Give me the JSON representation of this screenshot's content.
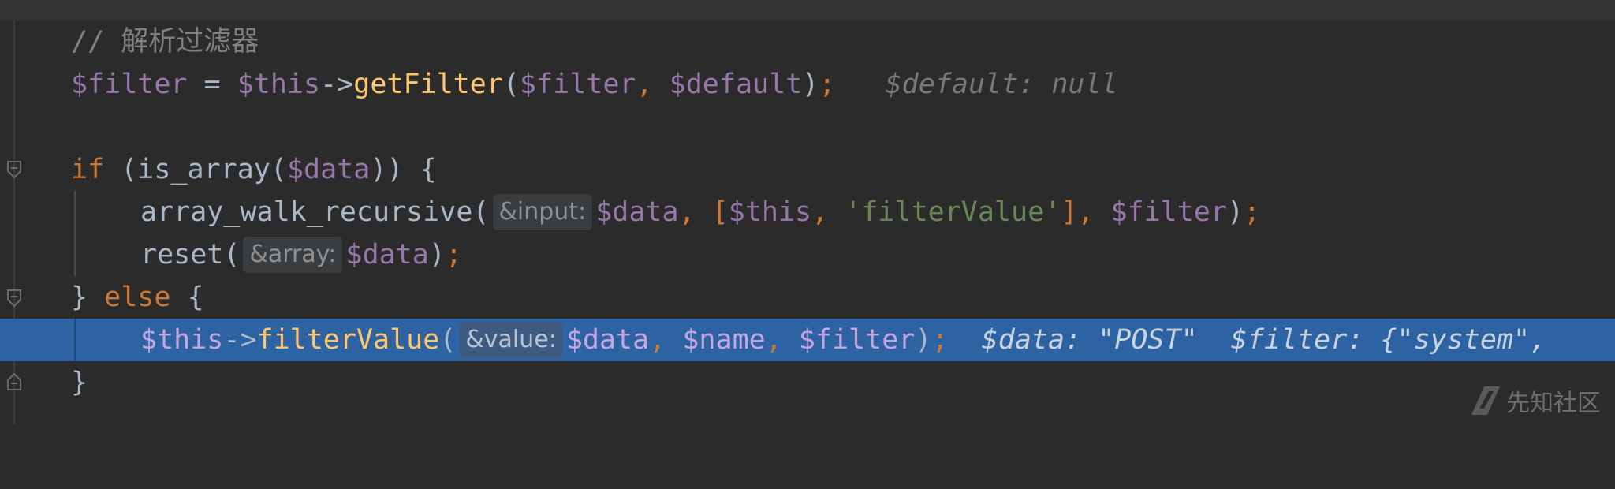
{
  "editor": {
    "lines": {
      "comment": "// 解析过滤器",
      "l2": {
        "var_filter": "$filter",
        "eq": " = ",
        "var_this": "$this",
        "arrow": "->",
        "fn": "getFilter",
        "open": "(",
        "arg1": "$filter",
        "comma": ", ",
        "arg2": "$default",
        "close": ")",
        "semi": ";",
        "inlay": "$default: null"
      },
      "l4": {
        "kw_if": "if",
        "p1": " (is_array(",
        "var": "$data",
        "p2": ")) {"
      },
      "l5": {
        "fn": "array_walk_recursive(",
        "hint": "&input:",
        "var_data": "$data",
        "c1": ", [",
        "var_this": "$this",
        "c2": ", ",
        "str": "'filterValue'",
        "c3": "], ",
        "var_filter": "$filter",
        "close": ")",
        "semi": ";"
      },
      "l6": {
        "fn": "reset(",
        "hint": "&array:",
        "var_data": "$data",
        "close": ")",
        "semi": ";"
      },
      "l7": {
        "brace1": "} ",
        "kw_else": "else",
        "brace2": " {"
      },
      "l8": {
        "var_this": "$this",
        "arrow": "->",
        "fn": "filterValue",
        "open": "(",
        "hint": "&value:",
        "var_data": "$data",
        "c1": ", ",
        "var_name": "$name",
        "c2": ", ",
        "var_filter": "$filter",
        "close": ")",
        "semi": ";",
        "inlay1": "$data: \"POST\"",
        "inlay2": "$filter: {\"system\","
      },
      "l9": "}"
    },
    "highlighted_line": 8
  },
  "watermark": {
    "text": "先知社区"
  }
}
